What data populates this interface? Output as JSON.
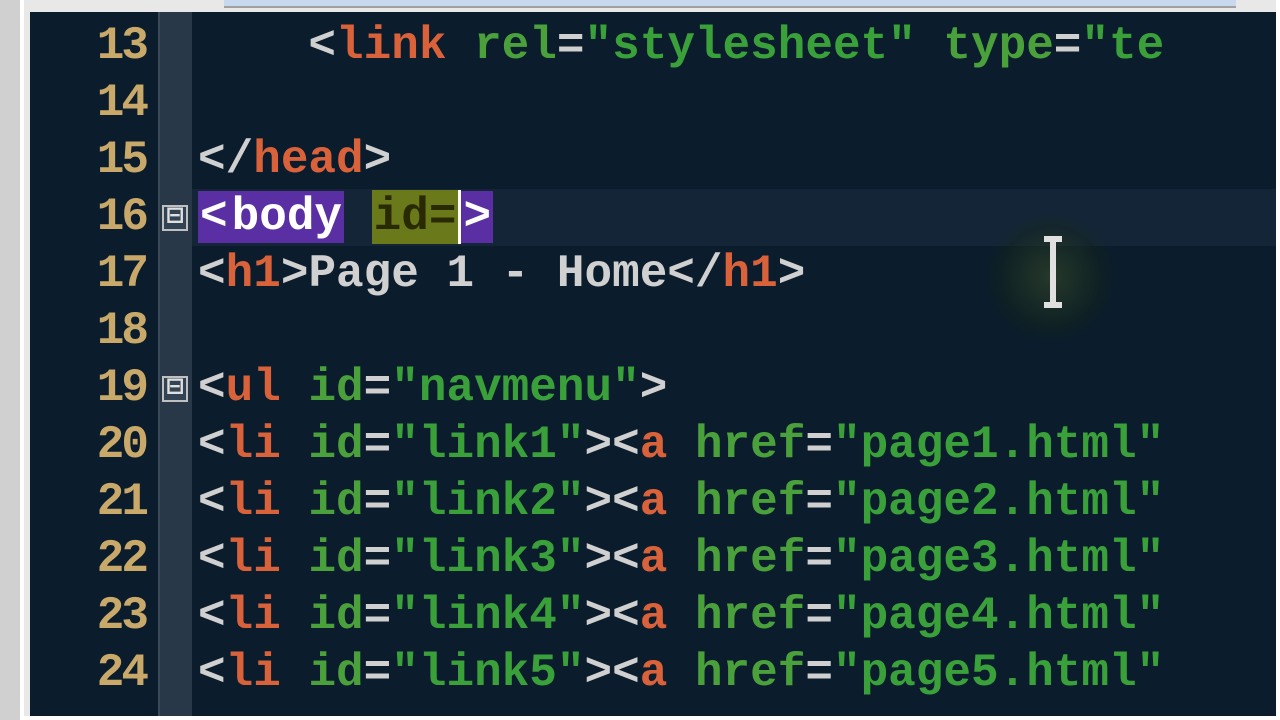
{
  "gutter": {
    "13": "13",
    "14": "14",
    "15": "15",
    "16": "16",
    "17": "17",
    "18": "18",
    "19": "19",
    "20": "20",
    "21": "21",
    "22": "22",
    "23": "23",
    "24": "24"
  },
  "fold": {
    "box": "⊟"
  },
  "code": {
    "l13": {
      "indent": "    ",
      "lt": "<",
      "tag": "link",
      "sp": " ",
      "a1": "rel",
      "eq": "=",
      "v1": "\"stylesheet\"",
      "a2": "type",
      "v2": "\"te"
    },
    "l15": {
      "lt": "</",
      "tag": "head",
      "gt": ">"
    },
    "l16": {
      "lt": "<",
      "tag": "body",
      "sp": " ",
      "attr": "id=",
      "gt": ">"
    },
    "l17": {
      "lt": "<",
      "tag": "h1",
      "gt": ">",
      "text": "Page 1 - Home",
      "clt": "</",
      "ctag": "h1",
      "cgt": ">"
    },
    "l19": {
      "lt": "<",
      "tag": "ul",
      "sp": " ",
      "a1": "id",
      "eq": "=",
      "v1": "\"navmenu\"",
      "gt": ">"
    },
    "li": {
      "lt": "<",
      "tag": "li",
      "sp": " ",
      "a1": "id",
      "eq": "=",
      "gt": ">",
      "alt": "<",
      "atag": "a",
      "asp": " ",
      "a2": "href"
    },
    "l20": {
      "id": "\"link1\"",
      "href": "\"page1.html\""
    },
    "l21": {
      "id": "\"link2\"",
      "href": "\"page2.html\""
    },
    "l22": {
      "id": "\"link3\"",
      "href": "\"page3.html\""
    },
    "l23": {
      "id": "\"link4\"",
      "href": "\"page4.html\""
    },
    "l24": {
      "id": "\"link5\"",
      "href": "\"page5.html\""
    }
  }
}
